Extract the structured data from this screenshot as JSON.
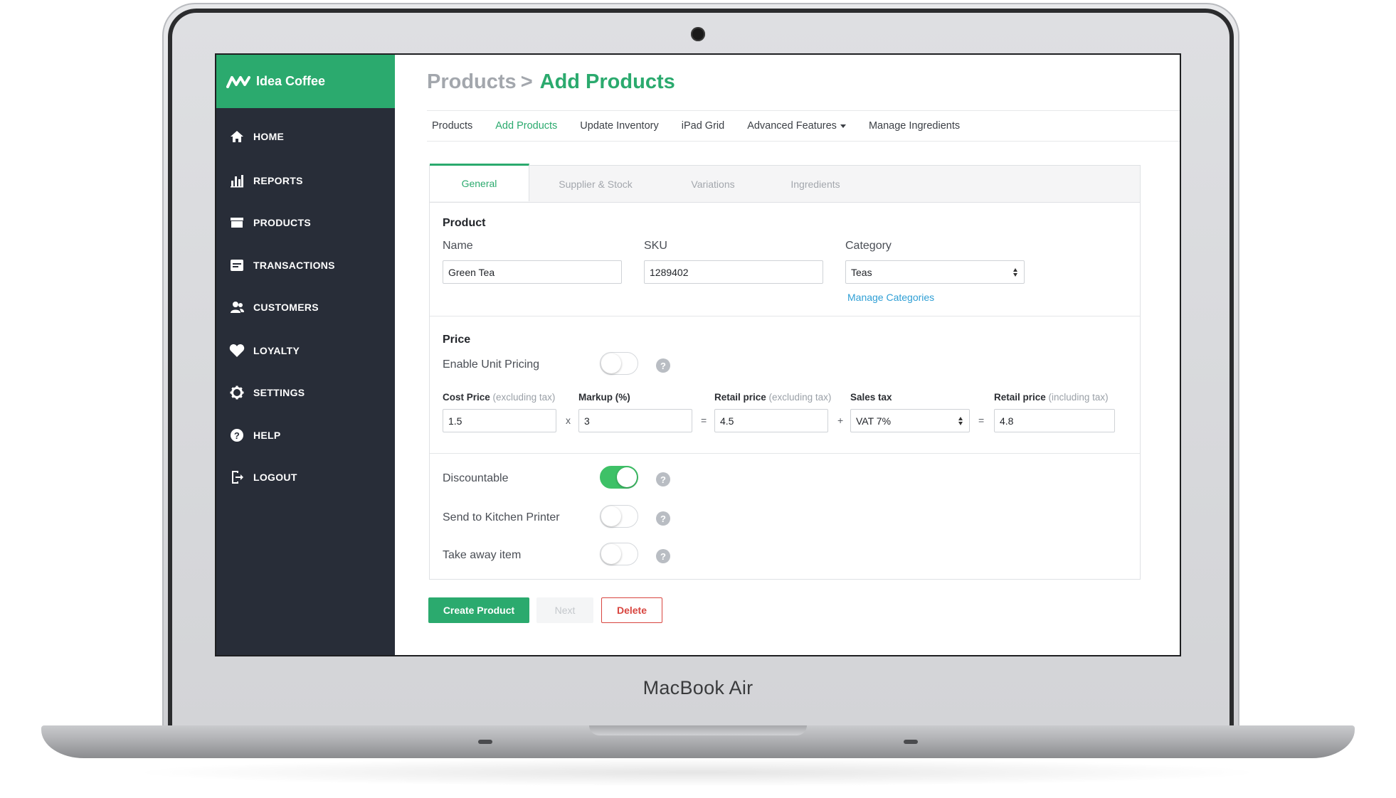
{
  "device": {
    "label": "MacBook Air"
  },
  "app": {
    "name": "Idea Coffee"
  },
  "sidebar": {
    "items": [
      {
        "label": "HOME",
        "icon": "home-icon"
      },
      {
        "label": "REPORTS",
        "icon": "bar-chart-icon"
      },
      {
        "label": "PRODUCTS",
        "icon": "box-icon"
      },
      {
        "label": "TRANSACTIONS",
        "icon": "receipt-icon"
      },
      {
        "label": "CUSTOMERS",
        "icon": "users-icon"
      },
      {
        "label": "LOYALTY",
        "icon": "heart-icon"
      },
      {
        "label": "SETTINGS",
        "icon": "gear-icon"
      },
      {
        "label": "HELP",
        "icon": "help-icon"
      },
      {
        "label": "LOGOUT",
        "icon": "logout-icon"
      }
    ]
  },
  "header": {
    "breadcrumb_parent": "Products",
    "breadcrumb_sep": ">",
    "title": "Add Products"
  },
  "subnav": {
    "items": [
      "Products",
      "Add Products",
      "Update Inventory",
      "iPad Grid",
      "Advanced Features",
      "Manage Ingredients"
    ],
    "active": "Add Products"
  },
  "tabs": {
    "items": [
      "General",
      "Supplier & Stock",
      "Variations",
      "Ingredients"
    ],
    "active": "General"
  },
  "product": {
    "section_title": "Product",
    "name_label": "Name",
    "name_value": "Green Tea",
    "sku_label": "SKU",
    "sku_value": "1289402",
    "category_label": "Category",
    "category_value": "Teas",
    "manage_categories": "Manage Categories"
  },
  "price": {
    "section_title": "Price",
    "enable_unit_pricing_label": "Enable Unit Pricing",
    "enable_unit_pricing_on": false,
    "cost_label": "Cost Price",
    "cost_note": "(excluding tax)",
    "cost_value": "1.5",
    "markup_label": "Markup (%)",
    "markup_value": "3",
    "retail_ex_label": "Retail price",
    "retail_ex_note": "(excluding tax)",
    "retail_ex_value": "4.5",
    "sales_tax_label": "Sales tax",
    "sales_tax_value": "VAT 7%",
    "retail_inc_label": "Retail price",
    "retail_inc_note": "(including tax)",
    "retail_inc_value": "4.8",
    "op_multiply": "x",
    "op_equals": "=",
    "op_plus": "+"
  },
  "options": {
    "discountable_label": "Discountable",
    "discountable_on": true,
    "kitchen_label": "Send to Kitchen Printer",
    "kitchen_on": false,
    "takeaway_label": "Take away item",
    "takeaway_on": false,
    "help_glyph": "?"
  },
  "actions": {
    "create": "Create Product",
    "next": "Next",
    "delete": "Delete"
  },
  "colors": {
    "accent": "#2baa6e",
    "sidebar_bg": "#282d38",
    "link": "#2f9fd5",
    "danger": "#d8453f",
    "toggle_on": "#3ec167"
  }
}
